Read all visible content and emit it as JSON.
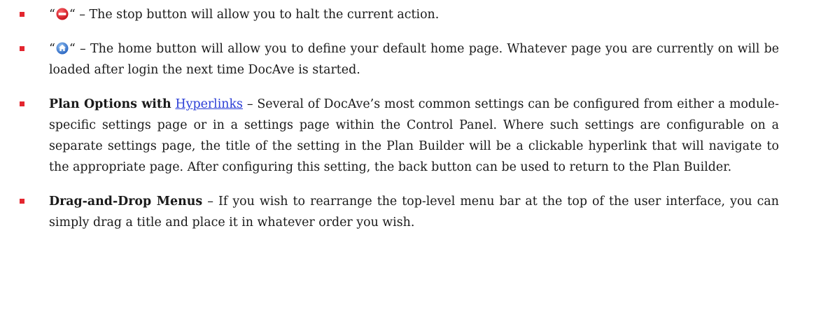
{
  "items": [
    {
      "quote_open": "“",
      "quote_close": "“",
      "icon": "stop-icon",
      "text": " – The stop button will allow you to halt the current action."
    },
    {
      "quote_open": "“",
      "quote_close": "“",
      "icon": "home-icon",
      "text": " – The home button will allow you to define your default home page. Whatever page you are currently on will be loaded after login the next time DocAve is started."
    },
    {
      "bold": "Plan Options with",
      "link": "Hyperlinks",
      "text": " – Several of DocAve’s most common settings can be configured from either a module-specific settings page or in a settings page within the Control Panel. Where such settings are configurable on a separate settings page, the title of the setting in the Plan Builder will be a clickable hyperlink that will navigate to the appropriate page. After configuring this setting, the back button can be used to return to the Plan Builder."
    },
    {
      "bold": "Drag-and-Drop Menus",
      "text": " – If you wish to rearrange the top-level menu bar at the top of the user interface, you can simply drag a title and place it in whatever order you wish."
    }
  ],
  "colors": {
    "bullet": "#e3262f",
    "link": "#2b3ed6",
    "stop_icon": "#e0202a",
    "home_icon": "#3a7fd6"
  }
}
